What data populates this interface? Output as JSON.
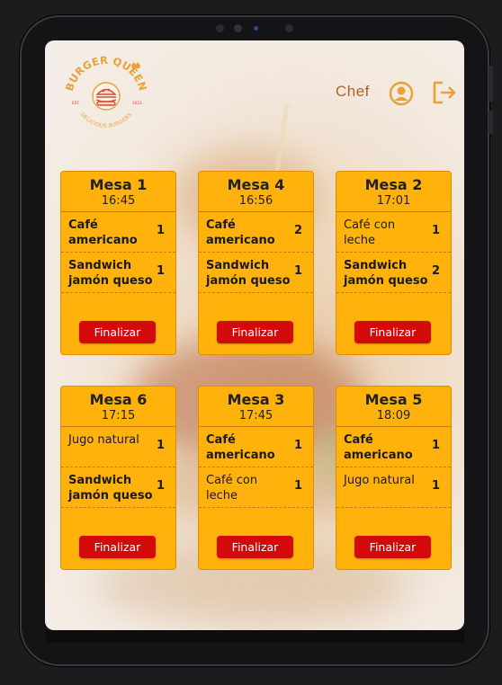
{
  "brand": {
    "top_text": "BURGER QUEEN",
    "bottom_text": "DELICIOUS BURGERS",
    "est_left": "EST.",
    "est_right": "2023."
  },
  "header": {
    "role_label": "Chef",
    "icons": [
      "user-icon",
      "logout-icon"
    ]
  },
  "colors": {
    "card_bg": "#ffb20c",
    "button_bg": "#d40a0a",
    "accent": "#e8a135"
  },
  "orders": [
    {
      "title": "Mesa 1",
      "time": "16:45",
      "button": "Finalizar",
      "items": [
        {
          "name": "Café americano",
          "qty": "1",
          "bold": true
        },
        {
          "name": "Sandwich jamón queso",
          "qty": "1",
          "bold": true
        }
      ]
    },
    {
      "title": "Mesa 4",
      "time": "16:56",
      "button": "Finalizar",
      "items": [
        {
          "name": "Café americano",
          "qty": "2",
          "bold": true
        },
        {
          "name": "Sandwich jamón queso",
          "qty": "1",
          "bold": true
        }
      ]
    },
    {
      "title": "Mesa 2",
      "time": "17:01",
      "button": "Finalizar",
      "items": [
        {
          "name": "Café con leche",
          "qty": "1",
          "bold": false
        },
        {
          "name": "Sandwich jamón queso",
          "qty": "2",
          "bold": true
        }
      ]
    },
    {
      "title": "Mesa 6",
      "time": "17:15",
      "button": "Finalizar",
      "items": [
        {
          "name": "Jugo natural",
          "qty": "1",
          "bold": false
        },
        {
          "name": "Sandwich jamón queso",
          "qty": "1",
          "bold": true
        }
      ]
    },
    {
      "title": "Mesa 3",
      "time": "17:45",
      "button": "Finalizar",
      "items": [
        {
          "name": "Café americano",
          "qty": "1",
          "bold": true
        },
        {
          "name": "Café con leche",
          "qty": "1",
          "bold": false
        }
      ]
    },
    {
      "title": "Mesa 5",
      "time": "18:09",
      "button": "Finalizar",
      "items": [
        {
          "name": "Café americano",
          "qty": "1",
          "bold": true
        },
        {
          "name": "Jugo natural",
          "qty": "1",
          "bold": false
        }
      ]
    }
  ]
}
